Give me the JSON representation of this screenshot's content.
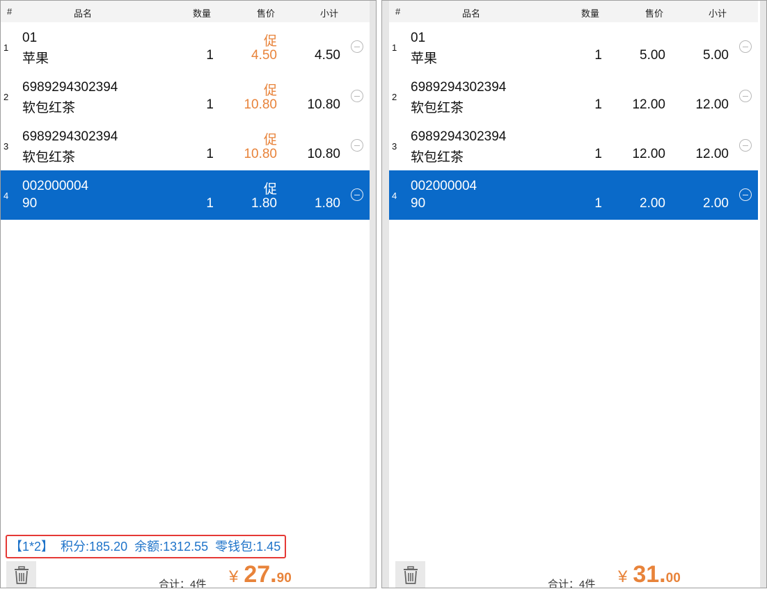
{
  "columns": {
    "num": "#",
    "name": "品名",
    "qty": "数量",
    "price": "售价",
    "subtotal": "小计"
  },
  "left": {
    "rows": [
      {
        "idx": "1",
        "code": "01",
        "name": "苹果",
        "qty": "1",
        "promo": "促",
        "price": "4.50",
        "subtotal": "4.50"
      },
      {
        "idx": "2",
        "code": "6989294302394",
        "name": "软包红茶",
        "qty": "1",
        "promo": "促",
        "price": "10.80",
        "subtotal": "10.80"
      },
      {
        "idx": "3",
        "code": "6989294302394",
        "name": "软包红茶",
        "qty": "1",
        "promo": "促",
        "price": "10.80",
        "subtotal": "10.80"
      },
      {
        "idx": "4",
        "code": "002000004",
        "name": "90",
        "qty": "1",
        "promo": "促",
        "price": "1.80",
        "subtotal": "1.80"
      }
    ],
    "member": {
      "id": "【1*2】",
      "points": "积分:185.20",
      "balance": "余额:1312.55",
      "wallet": "零钱包:1.45"
    },
    "footer": {
      "count": "合计：4件",
      "currency": "¥",
      "total_int": "27.",
      "total_dec": "90"
    }
  },
  "right": {
    "rows": [
      {
        "idx": "1",
        "code": "01",
        "name": "苹果",
        "qty": "1",
        "price": "5.00",
        "subtotal": "5.00"
      },
      {
        "idx": "2",
        "code": "6989294302394",
        "name": "软包红茶",
        "qty": "1",
        "price": "12.00",
        "subtotal": "12.00"
      },
      {
        "idx": "3",
        "code": "6989294302394",
        "name": "软包红茶",
        "qty": "1",
        "price": "12.00",
        "subtotal": "12.00"
      },
      {
        "idx": "4",
        "code": "002000004",
        "name": "90",
        "qty": "1",
        "price": "2.00",
        "subtotal": "2.00"
      }
    ],
    "footer": {
      "count": "合计：4件",
      "currency": "¥",
      "total_int": "31.",
      "total_dec": "00"
    }
  },
  "selected_row": "4",
  "colors": {
    "selected_bg": "#0a6ac9",
    "promo": "#e8833a",
    "member_text": "#1e73c9",
    "highlight_border": "#e53935"
  },
  "icons": {
    "remove": "minus-circle-icon",
    "delete": "trash-icon"
  }
}
